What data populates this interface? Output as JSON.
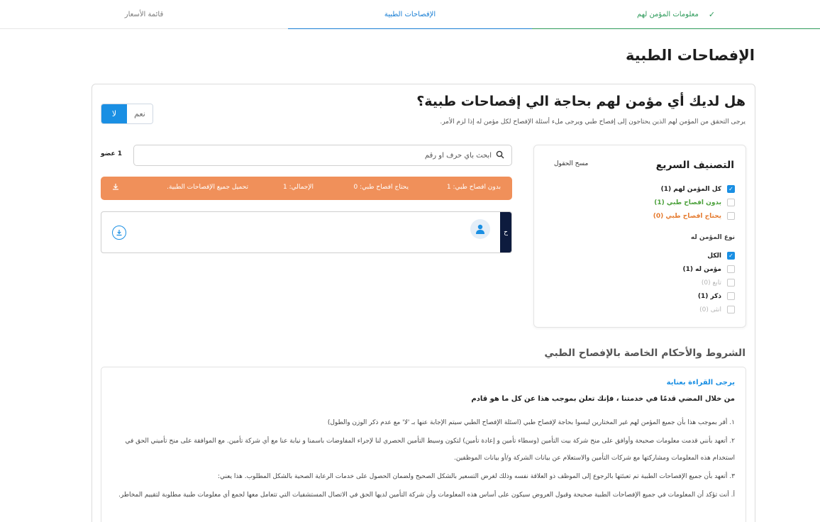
{
  "stepper": {
    "steps": [
      {
        "label": "معلومات المؤمن لهم",
        "state": "done"
      },
      {
        "label": "الإفصاحات الطبية",
        "state": "active"
      },
      {
        "label": "قائمة الأسعار",
        "state": "pending"
      }
    ]
  },
  "page": {
    "title": "الإفصاحات الطبية"
  },
  "question": {
    "title": "هل لديك أي مؤمن لهم بحاجة الي إفصاحات طبية؟",
    "subtitle": "يرجى التحقق من المؤمن لهم الذين يحتاجون إلى إفصاح طبي ويرجى ملء أسئلة الإفصاح لكل مؤمن له إذا لزم الأمر.",
    "yes_label": "نعم",
    "no_label": "لا",
    "selected": "no"
  },
  "filter": {
    "title": "التصنيف السريع",
    "clear_label": "مسح الحقول",
    "status_options": [
      {
        "label": "كل المؤمن لهم (1)",
        "checked": true
      },
      {
        "label": "بدون افصاح طبي (1)",
        "checked": false
      },
      {
        "label": "يحتاج افصاح طبي (0)",
        "checked": false
      }
    ],
    "type_title": "نوع المؤمن له",
    "type_options": [
      {
        "label": "الكل",
        "checked": true
      },
      {
        "label": "مؤمن له (1)",
        "checked": false
      },
      {
        "label": "تابع (0)",
        "checked": false
      },
      {
        "label": "ذكر (1)",
        "checked": false
      },
      {
        "label": "انثى (0)",
        "checked": false
      }
    ]
  },
  "search": {
    "placeholder": "ابحث بأي حرف او رقم",
    "members_count": "1 عضو"
  },
  "summary": {
    "without": "بدون افصاح طبي: 1",
    "needs": "يحتاج افصاح طبي: 0",
    "total": "الإجمالي: 1",
    "download_all": "تحميل جميع الإفصاحات الطبية."
  },
  "member": {
    "stripe_letter": "ح"
  },
  "terms": {
    "title": "الشروط والأحكام الخاصة بالإفصاح الطبي",
    "read_carefully": "يرجى القراءة بعناية",
    "lead": "من خلال المضي قدمًا في خدمتنا ، فإنك تعلن بموجب هذا عن كل ما هو قادم",
    "items": [
      "١. أقر بموجب هذا بأن جميع المؤمن لهم غير المختارين ليسوا بحاجة لإفصاح طبي (اسئلة الإفصاح الطبي سيتم الإجابة عنها بـ 'لا' مع عدم ذكر الوزن والطول)",
      "٢. أتعهد بأنني قدمت معلومات صحيحة وأوافق على منح شركة بيت التأمين (وسطاء تأمين و إعادة تأمين) لتكون وسيط التأمين الحصري لنا لإجراء المفاوضات باسمنا و نيابة عنا مع أي شركة تأمين. مع الموافقة على منح تأميني الحق في استخدام هذه المعلومات ومشاركتها مع شركات التأمين والاستعلام عن بيانات الشركة و/أو بيانات الموظفين.",
      "٣. أتعهد بأن جميع الإفصاحات الطبية تم تعبئتها بالرجوع إلى الموظف ذو العلاقة نفسه وذلك لغرض التسعير بالشكل الصحيح ولضمان الحصول على خدمات الرعاية الصحية بالشكل المطلوب. هذا يعني:",
      "أ. أنت تؤكد أن المعلومات في جميع الإفصاحات الطبية صحيحة وقبول العروض سيكون على أساس هذه المعلومات وأن شركة التأمين لديها الحق في الاتصال المستشفيات التي تتعامل معها لجمع أي معلومات طبية مطلوبة لتقييم المخاطر."
    ]
  }
}
